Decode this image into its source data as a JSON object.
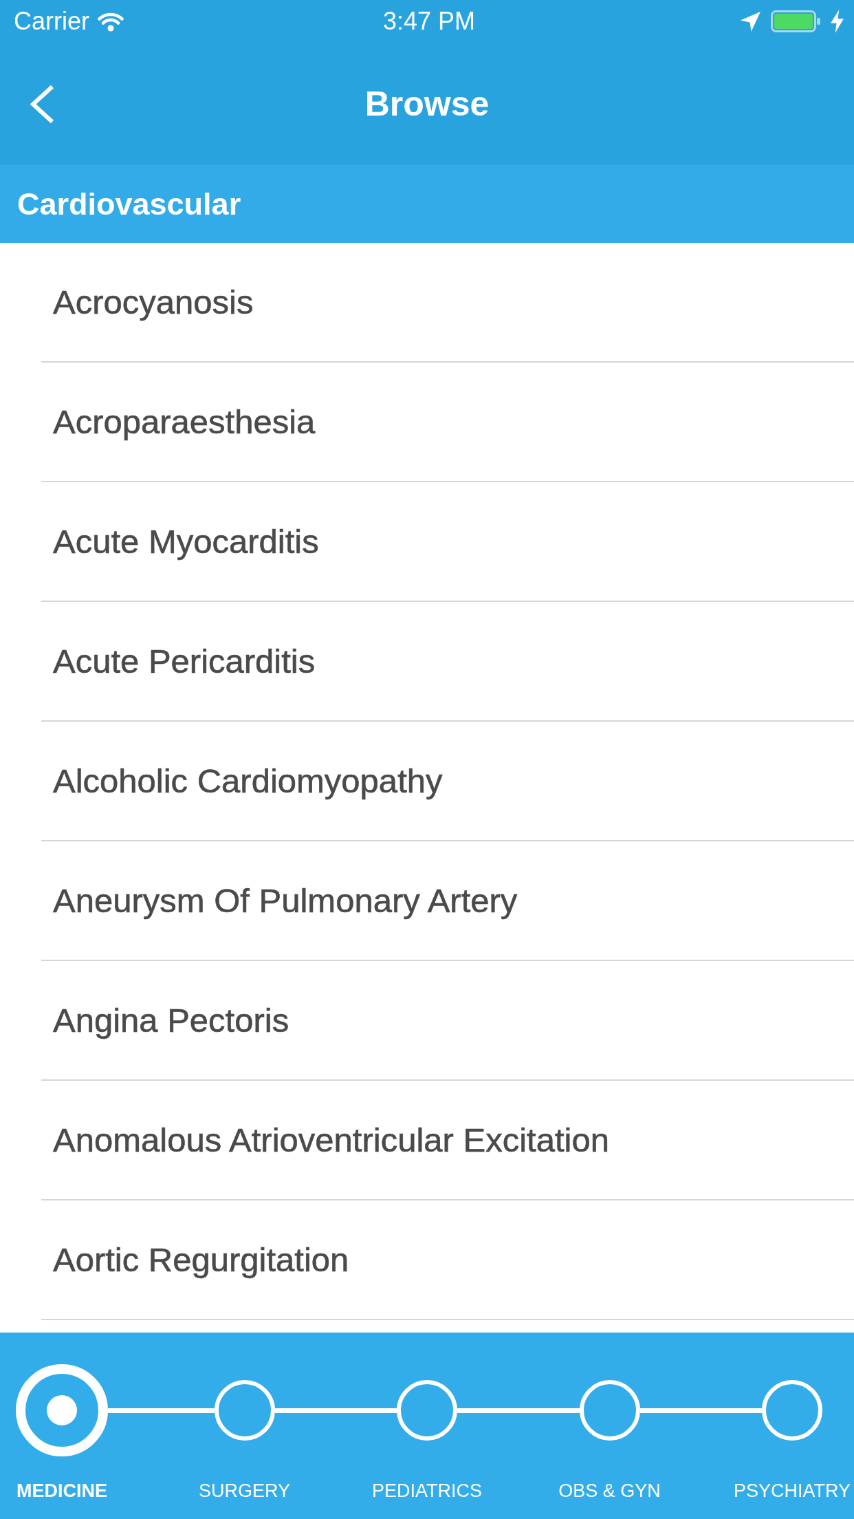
{
  "status_bar": {
    "carrier": "Carrier",
    "time": "3:47 PM"
  },
  "nav_bar": {
    "title": "Browse"
  },
  "section": {
    "title": "Cardiovascular"
  },
  "items": [
    "Acrocyanosis",
    "Acroparaesthesia",
    "Acute Myocarditis",
    "Acute Pericarditis",
    "Alcoholic Cardiomyopathy",
    "Aneurysm Of Pulmonary Artery",
    "Angina Pectoris",
    "Anomalous Atrioventricular Excitation",
    "Aortic Regurgitation"
  ],
  "tabs": [
    {
      "label": "MEDICINE",
      "selected": true
    },
    {
      "label": "SURGERY",
      "selected": false
    },
    {
      "label": "PEDIATRICS",
      "selected": false
    },
    {
      "label": "OBS & GYN",
      "selected": false
    },
    {
      "label": "PSYCHIATRY",
      "selected": false
    }
  ]
}
